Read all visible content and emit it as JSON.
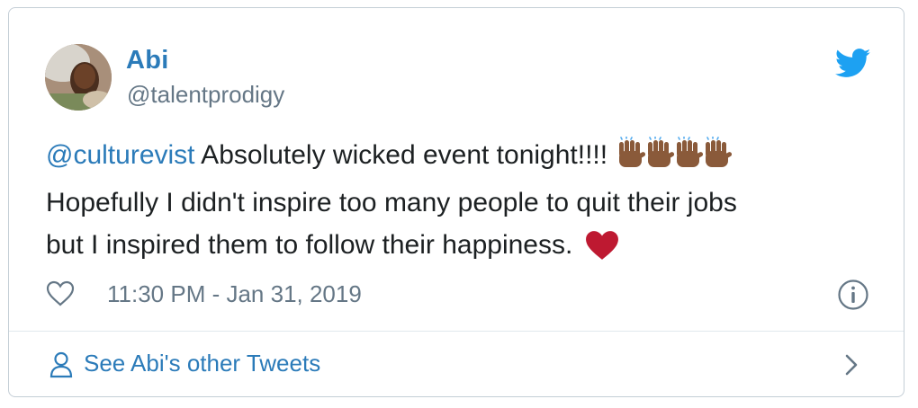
{
  "tweet": {
    "author_name": "Abi",
    "author_handle": "@talentprodigy",
    "mention": "@culturevist",
    "line1_rest": " Absolutely wicked event tonight!!!!",
    "line2": "Hopefully I didn't inspire too many people to quit their jobs",
    "line3": "but I inspired them to follow their happiness.",
    "timestamp": "11:30 PM - Jan 31, 2019"
  },
  "footer": {
    "see_more_label": "See Abi's other Tweets"
  },
  "icons": {
    "brand": "twitter-bird-icon",
    "like": "heart-outline-icon",
    "info": "info-icon",
    "person": "person-icon",
    "chevron": "chevron-right-icon",
    "emoji_hands": "raising-hands-medium-dark-skin-emoji",
    "emoji_heart": "red-heart-emoji"
  },
  "colors": {
    "link": "#2b7bb9",
    "muted": "#657786",
    "text": "#1c2022",
    "border": "#c4ced6",
    "heart": "#be1931",
    "skin": "#8a5a3a"
  }
}
